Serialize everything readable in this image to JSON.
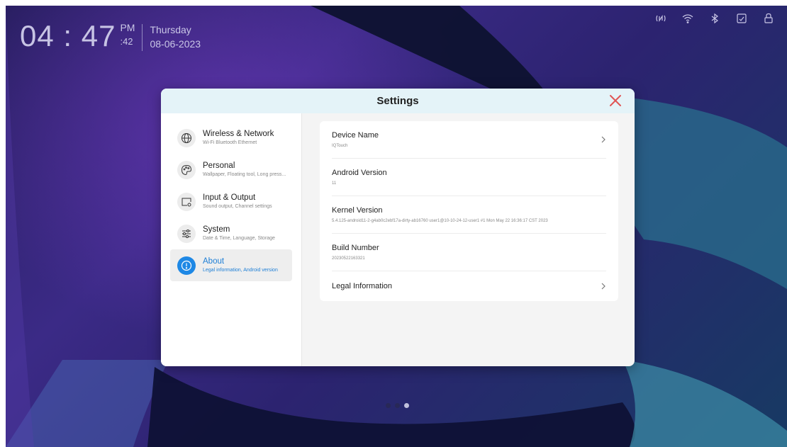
{
  "status_bar": {
    "time": "04 : 47",
    "am_pm": "PM",
    "seconds": ":42",
    "weekday": "Thursday",
    "date": "08-06-2023",
    "icons": [
      "nfc-icon",
      "wifi-icon",
      "bluetooth-icon",
      "screenshot-icon",
      "lock-icon"
    ]
  },
  "dialog": {
    "title": "Settings"
  },
  "sidebar": {
    "items": [
      {
        "label": "Wireless & Network",
        "sub": "Wi-Fi Bluetooth Ethernet",
        "icon": "globe-icon"
      },
      {
        "label": "Personal",
        "sub": "Wallpaper, Floating tool, Long press...",
        "icon": "palette-icon"
      },
      {
        "label": "Input & Output",
        "sub": "Sound output, Channel settings",
        "icon": "input-output-icon"
      },
      {
        "label": "System",
        "sub": "Date & Time, Language, Storage",
        "icon": "sliders-icon"
      },
      {
        "label": "About",
        "sub": "Legal information, Android version",
        "icon": "info-icon",
        "selected": true
      }
    ]
  },
  "about": {
    "rows": [
      {
        "title": "Device Name",
        "value": "IQTouch",
        "chevron": true
      },
      {
        "title": "Android Version",
        "value": "11"
      },
      {
        "title": "Kernel Version",
        "value": "5.4.125-android11-2-g4ab0c2ebf17a-dirty-ab16760 user1@10-10-24-12-user1 #1 Mon May 22 16:36:17 CST 2023"
      },
      {
        "title": "Build Number",
        "value": "20230522163321"
      },
      {
        "title": "Legal Information",
        "value": "",
        "chevron": true
      }
    ]
  },
  "page_indicator": {
    "count": 3,
    "active": 3
  },
  "colors": {
    "accent": "#1e88e5",
    "close": "#e05555",
    "header_bg": "#e4f3f8"
  }
}
